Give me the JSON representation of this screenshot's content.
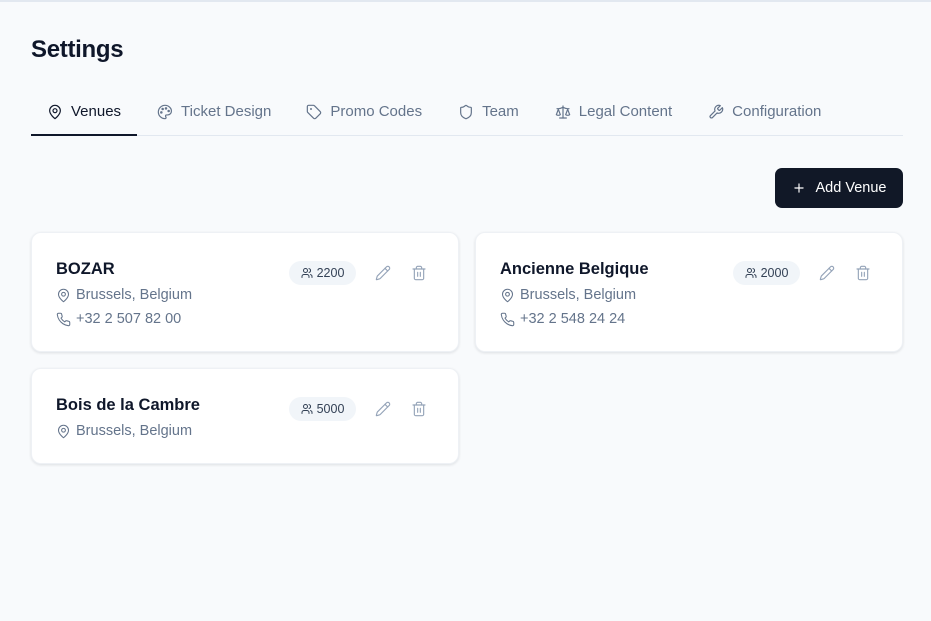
{
  "page": {
    "title": "Settings"
  },
  "tabs": [
    {
      "label": "Venues",
      "icon": "map-pin-icon",
      "active": true
    },
    {
      "label": "Ticket Design",
      "icon": "palette-icon",
      "active": false
    },
    {
      "label": "Promo Codes",
      "icon": "tag-icon",
      "active": false
    },
    {
      "label": "Team",
      "icon": "shield-icon",
      "active": false
    },
    {
      "label": "Legal Content",
      "icon": "scale-icon",
      "active": false
    },
    {
      "label": "Configuration",
      "icon": "wrench-icon",
      "active": false
    }
  ],
  "actions": {
    "add_venue_label": "Add Venue"
  },
  "venues": [
    {
      "name": "BOZAR",
      "location": "Brussels, Belgium",
      "phone": "+32 2 507 82 00",
      "capacity": "2200"
    },
    {
      "name": "Ancienne Belgique",
      "location": "Brussels, Belgium",
      "phone": "+32 2 548 24 24",
      "capacity": "2000"
    },
    {
      "name": "Bois de la Cambre",
      "location": "Brussels, Belgium",
      "phone": "",
      "capacity": "5000"
    }
  ],
  "colors": {
    "primary": "#111827",
    "muted_text": "#64748b",
    "background": "#f8fafc",
    "badge_bg": "#f1f5f9"
  }
}
